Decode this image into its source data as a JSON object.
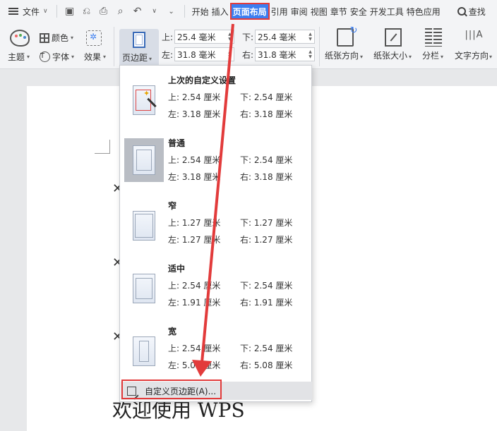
{
  "menubar": {
    "file_label": "文件",
    "tabs": [
      "开始",
      "插入",
      "页面布局",
      "引用",
      "审阅",
      "视图",
      "章节",
      "安全",
      "开发工具",
      "特色应用"
    ],
    "active_tab": "页面布局",
    "search_label": "查找"
  },
  "ribbon": {
    "theme_label": "主题",
    "color_label": "颜色",
    "font_label": "字体",
    "effect_label": "效果",
    "margin_label": "页边距",
    "top_label": "上:",
    "bottom_label": "下:",
    "left_label": "左:",
    "right_label": "右:",
    "top_value": "25.4 毫米",
    "bottom_value": "25.4 毫米",
    "left_value": "31.8 毫米",
    "right_value": "31.8 毫米",
    "orientation_label": "纸张方向",
    "size_label": "纸张大小",
    "columns_label": "分栏",
    "text_dir_label": "文字方向"
  },
  "dropdown": {
    "options": [
      {
        "title": "上次的自定义设置",
        "top": "上: 2.54 厘米",
        "bottom": "下: 2.54 厘米",
        "left": "左: 3.18 厘米",
        "right": "右: 3.18 厘米"
      },
      {
        "title": "普通",
        "top": "上: 2.54 厘米",
        "bottom": "下: 2.54 厘米",
        "left": "左: 3.18 厘米",
        "right": "右: 3.18 厘米"
      },
      {
        "title": "窄",
        "top": "上: 1.27 厘米",
        "bottom": "下: 1.27 厘米",
        "left": "左: 1.27 厘米",
        "right": "右: 1.27 厘米"
      },
      {
        "title": "适中",
        "top": "上: 2.54 厘米",
        "bottom": "下: 2.54 厘米",
        "left": "左: 1.91 厘米",
        "right": "右: 1.91 厘米"
      },
      {
        "title": "宽",
        "top": "上: 2.54 厘米",
        "bottom": "下: 2.54 厘米",
        "left": "左: 5.08 厘米",
        "right": "右: 5.08 厘米"
      }
    ],
    "custom_label": "自定义页边距(A)..."
  },
  "document": {
    "welcome_text": "欢迎使用 WPS"
  },
  "colors": {
    "accent": "#3c7ef0",
    "highlight_red": "#e23b3b"
  }
}
